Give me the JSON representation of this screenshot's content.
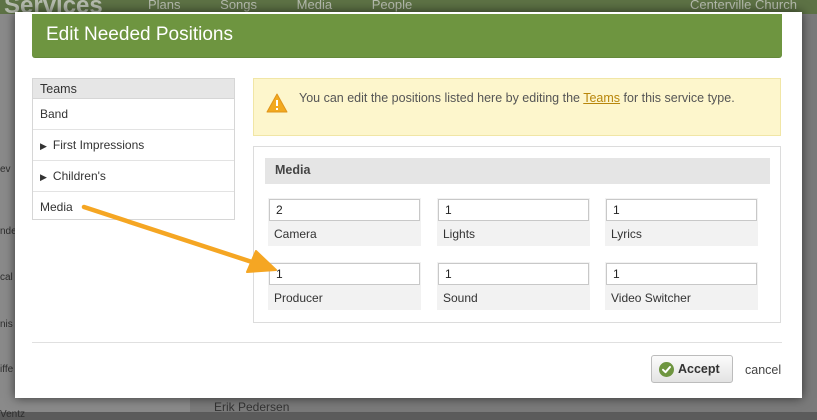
{
  "background": {
    "logo": "Services",
    "nav": [
      "Plans",
      "Songs",
      "Media",
      "People"
    ],
    "org": "Centerville Church",
    "person": "Erik Pedersen"
  },
  "modal": {
    "title": "Edit Needed Positions",
    "teams": {
      "header": "Teams",
      "items": [
        {
          "label": "Band",
          "expandable": false
        },
        {
          "label": "First Impressions",
          "expandable": true
        },
        {
          "label": "Children's",
          "expandable": true
        },
        {
          "label": "Media",
          "expandable": false
        }
      ]
    },
    "warning": {
      "text_before": "You can edit the positions listed here by editing the ",
      "link": "Teams",
      "text_after": " for this service type."
    },
    "panel": {
      "title": "Media",
      "positions": [
        {
          "value": "2",
          "label": "Camera"
        },
        {
          "value": "1",
          "label": "Lights"
        },
        {
          "value": "1",
          "label": "Lyrics"
        },
        {
          "value": "1",
          "label": "Producer"
        },
        {
          "value": "1",
          "label": "Sound"
        },
        {
          "value": "1",
          "label": "Video Switcher"
        }
      ]
    },
    "footer": {
      "accept": "Accept",
      "cancel": "cancel"
    }
  },
  "colors": {
    "header_green": "#6e9540",
    "warning_bg": "#fdf6cc",
    "warning_icon": "#f2a91f",
    "arrow": "#f5a623"
  },
  "icons": {
    "warning": "warning-triangle-icon",
    "accept": "check-circle-icon",
    "expand": "triangle-right-icon"
  }
}
